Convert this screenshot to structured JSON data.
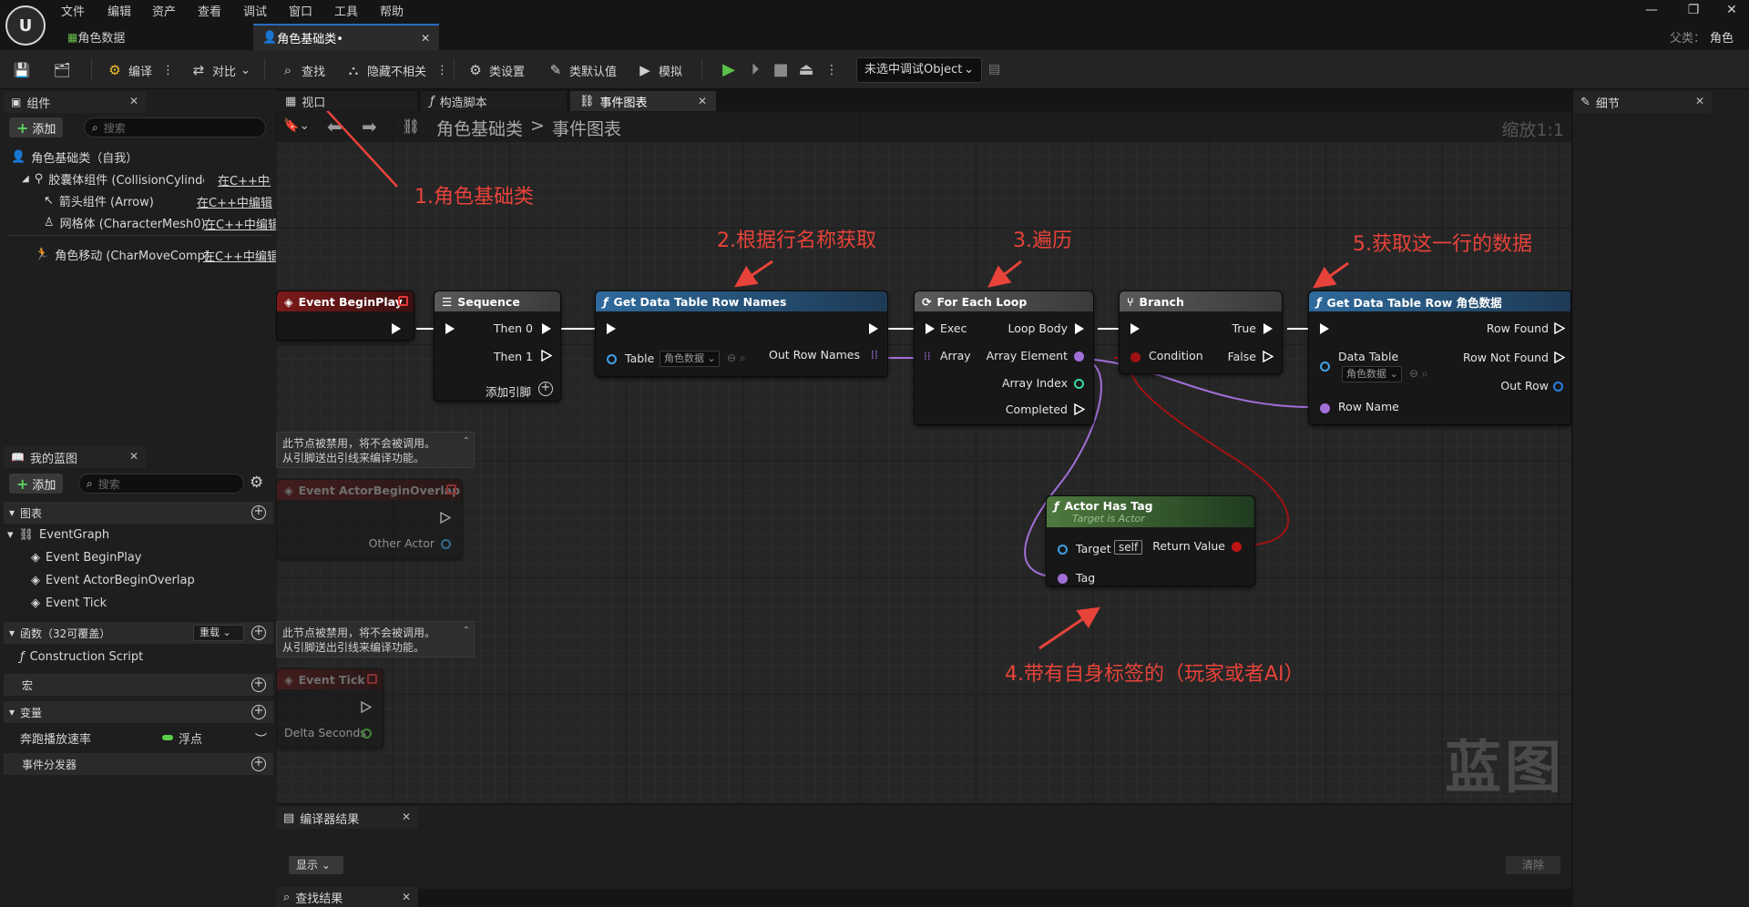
{
  "menu": [
    "文件",
    "编辑",
    "资产",
    "查看",
    "调试",
    "窗口",
    "工具",
    "帮助"
  ],
  "doc_tabs": [
    {
      "label": "角色数据"
    },
    {
      "label": "角色基础类•"
    }
  ],
  "parent_class": {
    "label": "父类：",
    "value": "角色"
  },
  "toolbar": {
    "compile": "编译",
    "diff": "对比",
    "find": "查找",
    "hide_unrelated": "隐藏不相关",
    "class_settings": "类设置",
    "class_defaults": "类默认值",
    "simulate": "模拟",
    "debug_object": "未选中调试Object"
  },
  "components_panel": {
    "title": "组件",
    "add": "添加",
    "search_placeholder": "搜索",
    "items": [
      {
        "label": "角色基础类（自我）"
      },
      {
        "label": "胶囊体组件 (CollisionCylinder)",
        "link": "在C++中编"
      },
      {
        "label": "箭头组件 (Arrow)",
        "link": "在C++中编辑"
      },
      {
        "label": "网格体 (CharacterMesh0)",
        "link": "在C++中编辑"
      },
      {
        "label": "角色移动 (CharMoveComp)",
        "link": "在C++中编辑"
      }
    ]
  },
  "graph_tabs": [
    {
      "label": "视口"
    },
    {
      "label": "构造脚本"
    },
    {
      "label": "事件图表"
    }
  ],
  "breadcrumb": {
    "root": "角色基础类",
    "sep": ">",
    "current": "事件图表",
    "zoom": "缩放1:1"
  },
  "watermark": "蓝图",
  "my_blueprint": {
    "title": "我的蓝图",
    "add": "添加",
    "search_placeholder": "搜索",
    "graphs_label": "图表",
    "event_graph": "EventGraph",
    "events": [
      "Event BeginPlay",
      "Event ActorBeginOverlap",
      "Event Tick"
    ],
    "functions_label": "函数（32可覆盖）",
    "override": "重载",
    "construction_script": "Construction Script",
    "macros_label": "宏",
    "variables_label": "变量",
    "variable": {
      "name": "奔跑播放速率",
      "type": "浮点"
    },
    "dispatchers_label": "事件分发器"
  },
  "nodes": {
    "begin_play": {
      "title": "Event BeginPlay"
    },
    "sequence": {
      "title": "Sequence",
      "then0": "Then 0",
      "then1": "Then 1",
      "add_pin": "添加引脚"
    },
    "get_row_names": {
      "title": "Get Data Table Row Names",
      "table": "Table",
      "table_value": "角色数据",
      "out": "Out Row Names"
    },
    "for_each": {
      "title": "For Each Loop",
      "exec": "Exec",
      "loop_body": "Loop Body",
      "array": "Array",
      "array_element": "Array Element",
      "array_index": "Array Index",
      "completed": "Completed"
    },
    "branch": {
      "title": "Branch",
      "true": "True",
      "false": "False",
      "condition": "Condition"
    },
    "get_row": {
      "title": "Get Data Table Row 角色数据",
      "row_found": "Row Found",
      "row_not_found": "Row Not Found",
      "data_table": "Data Table",
      "data_table_value": "角色数据",
      "out_row": "Out Row",
      "row_name": "Row Name"
    },
    "has_tag": {
      "title": "Actor Has Tag",
      "subtitle": "Target is Actor",
      "target": "Target",
      "self": "self",
      "return_value": "Return Value",
      "tag": "Tag"
    },
    "overlap": {
      "title": "Event ActorBeginOverlap",
      "other_actor": "Other Actor"
    },
    "tick": {
      "title": "Event Tick",
      "delta": "Delta Seconds"
    },
    "disabled_comment": [
      "此节点被禁用，将不会被调用。",
      "从引脚送出引线来编译功能。"
    ]
  },
  "annotations": [
    "1.角色基础类",
    "2.根据行名称获取",
    "3.遍历",
    "4.带有自身标签的（玩家或者AI）",
    "5.获取这一行的数据"
  ],
  "compiler_results": {
    "title": "编译器结果",
    "show": "显示",
    "clear": "清除"
  },
  "find_results": {
    "title": "查找结果"
  },
  "details_panel": {
    "title": "细节"
  },
  "colors": {
    "accent": "#2b6ac2",
    "annotation": "#e8433a",
    "function_header": "#3d6e8f",
    "pure_header": "#4f7a3f",
    "event_header": "#7a1a1a"
  }
}
